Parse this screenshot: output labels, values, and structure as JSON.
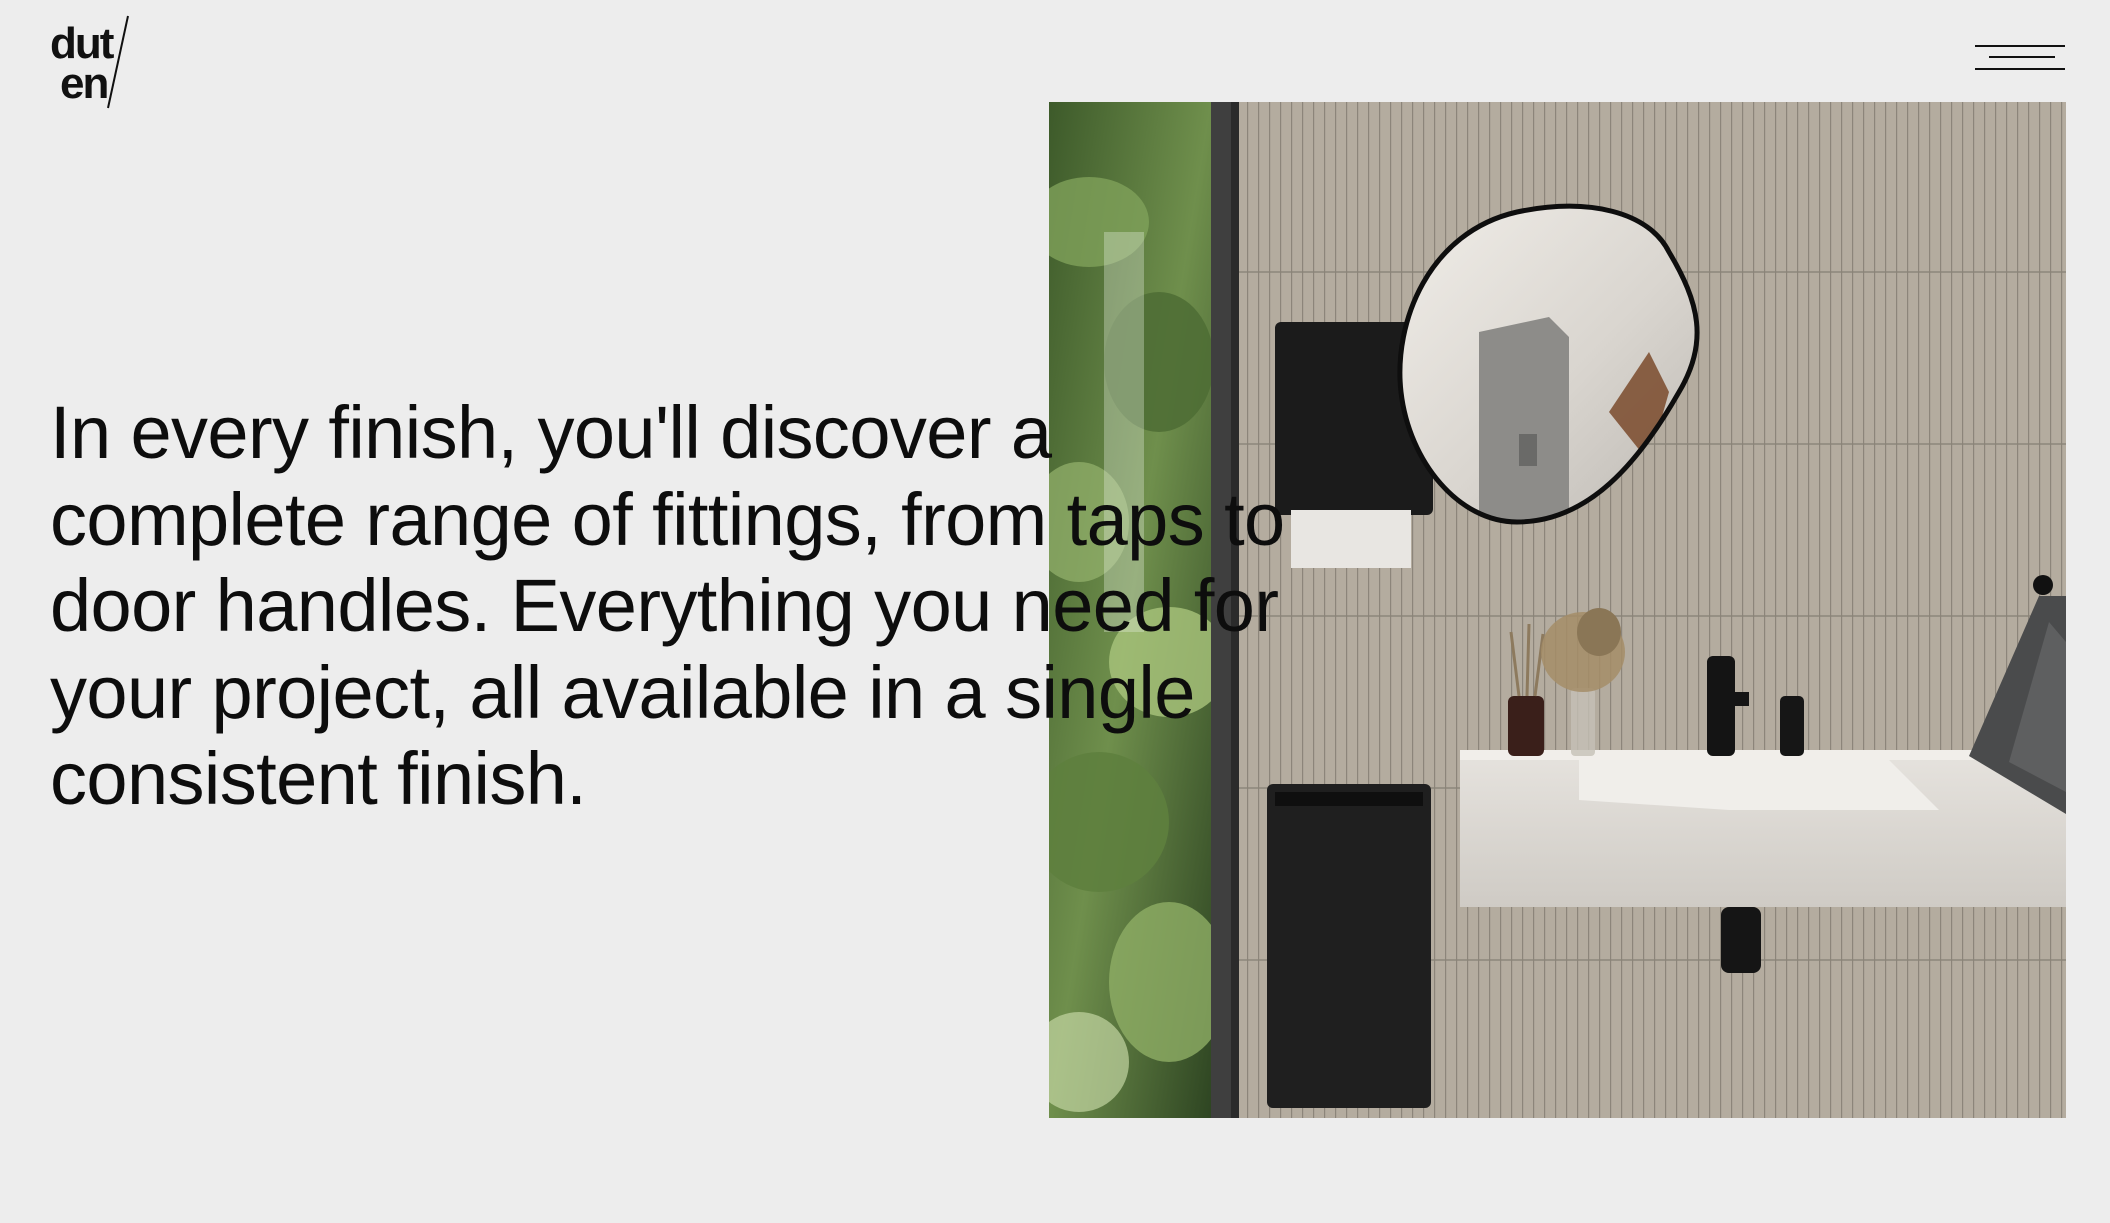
{
  "brand": {
    "logo_line1": "dut",
    "logo_line2": "en"
  },
  "header": {
    "menu_icon": "hamburger-menu-icon"
  },
  "hero": {
    "text": "In every finish, you'll discover a complete range of fittings, from taps to door handles. Everything you need for your project, all available in a single consistent finish.",
    "image_subject": "bathroom-scene",
    "colors": {
      "background": "#ededed",
      "text": "#0d0d0d",
      "tile": "#b3ab9f"
    }
  }
}
